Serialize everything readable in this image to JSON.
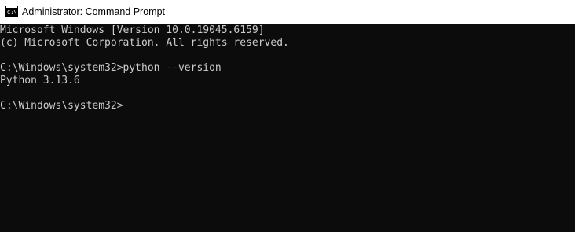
{
  "window": {
    "title": "Administrator: Command Prompt",
    "icon": "cmd-icon"
  },
  "console": {
    "background": "#0c0c0c",
    "text_color": "#cccccc",
    "lines": [
      "Microsoft Windows [Version 10.0.19045.6159]",
      "(c) Microsoft Corporation. All rights reserved.",
      "",
      "C:\\Windows\\system32>python --version",
      "Python 3.13.6",
      "",
      "C:\\Windows\\system32>"
    ]
  }
}
